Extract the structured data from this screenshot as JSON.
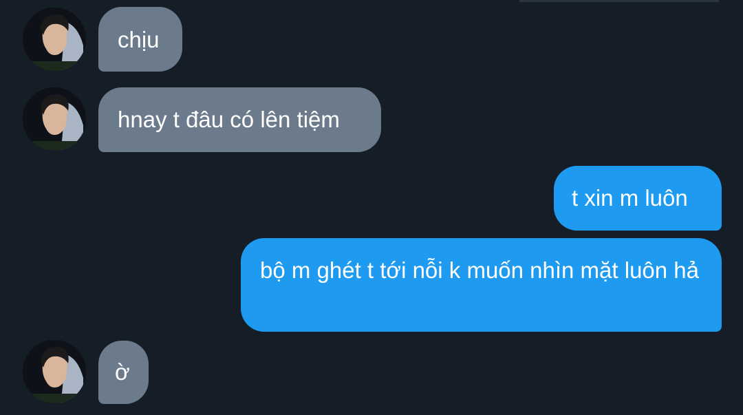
{
  "chat": {
    "messages": [
      {
        "direction": "incoming",
        "text": "chịu"
      },
      {
        "direction": "incoming",
        "text": "hnay t đâu có lên tiệm"
      },
      {
        "direction": "outgoing",
        "text": "t xin m luôn"
      },
      {
        "direction": "outgoing",
        "text": "bộ m ghét t tới nỗi k muốn nhìn mặt luôn hả"
      },
      {
        "direction": "incoming",
        "text": "ờ"
      }
    ]
  },
  "colors": {
    "background": "#151d27",
    "incoming_bubble": "#6b7b8c",
    "outgoing_bubble": "#1e9bf0",
    "text": "#ffffff"
  },
  "icons": {
    "contact_avatar": "contact-avatar-photo"
  }
}
